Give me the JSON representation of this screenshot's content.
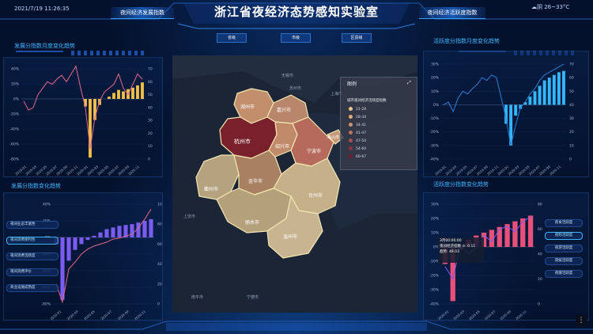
{
  "header": {
    "title": "浙江省夜经济态势感知实验室",
    "datetime": "2021/7/19 11:26:35",
    "weather": "阴 26~33°C",
    "tab_left": "夜间经济发展指数",
    "tab_right": "夜间经济活跃度指数",
    "subtabs": [
      "省级",
      "市级",
      "区县级"
    ]
  },
  "colors": {
    "accent": "#3fb6ff",
    "yellow": "#f0c04a",
    "pink": "#e05577",
    "purple": "#7a5cf0",
    "cyan": "#33b7ff",
    "line": "#e06a8a"
  },
  "panels": {
    "tl_title": "发展分指数月度变化趋势",
    "bl_title": "发展分指数变化趋势",
    "tr_title": "活跃度分指数月度变化趋势",
    "br_title": "活跃度分指数变化趋势"
  },
  "left_buttons": [
    "夜间业态丰富性",
    "夜间消费便利性",
    "夜间消费活跃度",
    "夜间消费评价",
    "商业设施成熟度"
  ],
  "right_buttons": [
    "夜食活跃度",
    "夜购活跃度",
    "夜游活跃度",
    "夜娱活跃度",
    "夜健活跃度"
  ],
  "map": {
    "legend_title": "图例",
    "legend_subtitle": "城市夜间经济活跃度指数",
    "legend_items": [
      {
        "label": "21-28",
        "color": "#e8c88a"
      },
      {
        "label": "28-34",
        "color": "#e0b07a"
      },
      {
        "label": "34-41",
        "color": "#d3926a"
      },
      {
        "label": "41-47",
        "color": "#c2715c"
      },
      {
        "label": "47-54",
        "color": "#a9504d"
      },
      {
        "label": "54-60",
        "color": "#8e3340"
      },
      {
        "label": "60-67",
        "color": "#731c30"
      }
    ],
    "cities": [
      "湖州市",
      "嘉兴市",
      "杭州市",
      "绍兴市",
      "宁波市",
      "舟山市",
      "衢州市",
      "金华市",
      "台州市",
      "丽水市",
      "温州市"
    ],
    "basemap_labels": [
      "无锡市",
      "苏州市",
      "上海市",
      "上饶市",
      "南平市",
      "宁德市"
    ]
  },
  "tooltip": {
    "line1": "3月00:00:00",
    "line2": "夜间经济指数 ⊙: 0.11",
    "line3": "趋势: 49.03"
  },
  "chart_data": [
    {
      "type": "bar",
      "title": "发展分指数月度变化趋势",
      "y_ticks": [
        "40%",
        "20%",
        "0%",
        "-20%",
        "-40%",
        "-60%",
        "-80%"
      ],
      "y2_ticks": [
        "70",
        "60",
        "50",
        "40",
        "30",
        "20",
        "10",
        "0"
      ],
      "x_ticks": [
        "2019-01",
        "2019-03",
        "2019-05",
        "2019-07",
        "2019-09",
        "2019-11",
        "2020-01",
        "2020-03",
        "2020-05",
        "2020-07",
        "2020-09",
        "2020-11"
      ],
      "series": [
        {
          "values": [
            0,
            0,
            0,
            0,
            0,
            0,
            0,
            0,
            0,
            0,
            0,
            0,
            0,
            -10,
            -78,
            -28,
            -8,
            0,
            3,
            8,
            12,
            10,
            13,
            15,
            18,
            22
          ]
        },
        {
          "values": [
            45,
            38,
            40,
            50,
            55,
            60,
            58,
            62,
            65,
            60,
            66,
            72,
            55,
            40,
            8,
            32,
            45,
            52,
            55,
            58,
            66,
            55,
            50,
            58,
            66,
            62
          ]
        }
      ]
    },
    {
      "type": "bar",
      "title": "发展分指数变化趋势",
      "y_ticks": [
        "40%",
        "20%",
        "0%",
        "-20%",
        "-40%",
        "-60%",
        "-80%"
      ],
      "y2_ticks": [
        "100",
        "80",
        "60",
        "40",
        "20",
        "0"
      ],
      "x_ticks": [
        "2020-01",
        "2020-03",
        "2020-05",
        "2020-07",
        "2020-09",
        "2020-11"
      ],
      "series": [
        {
          "values": [
            -8,
            -75,
            -28,
            -15,
            -8,
            -3,
            2,
            6,
            10,
            12,
            14,
            15,
            16,
            18,
            20,
            22
          ]
        },
        {
          "values": [
            20,
            2,
            35,
            42,
            50,
            55,
            58,
            60,
            62,
            65,
            66,
            68,
            70,
            76,
            85,
            95
          ]
        }
      ]
    },
    {
      "type": "bar",
      "title": "活跃度分指数月度变化趋势",
      "y_ticks": [
        "30%",
        "20%",
        "10%",
        "0%",
        "-10%",
        "-20%",
        "-30%",
        "-40%"
      ],
      "y2_ticks": [
        "70",
        "60",
        "50",
        "40",
        "30",
        "20",
        "10",
        "0"
      ],
      "x_ticks": [
        "2019-01",
        "2019-03",
        "2019-05",
        "2019-07",
        "2019-09",
        "2019-11",
        "2020-01",
        "2020-03",
        "2020-05",
        "2020-07",
        "2020-09",
        "2020-11"
      ],
      "series": [
        {
          "values": [
            0,
            0,
            0,
            0,
            0,
            0,
            0,
            0,
            0,
            0,
            0,
            0,
            0,
            -14,
            -30,
            -8,
            -3,
            2,
            6,
            10,
            14,
            18,
            20,
            22,
            24,
            25
          ]
        },
        {
          "values": [
            40,
            42,
            35,
            45,
            50,
            48,
            52,
            55,
            60,
            58,
            62,
            60,
            45,
            30,
            10,
            25,
            38,
            42,
            48,
            52,
            58,
            62,
            64,
            66,
            68,
            70
          ]
        }
      ]
    },
    {
      "type": "bar",
      "title": "活跃度分指数变化趋势",
      "y_ticks": [
        "30%",
        "20%",
        "10%",
        "0%",
        "-10%",
        "-20%",
        "-30%",
        "-40%"
      ],
      "y2_ticks": [
        "80",
        "60",
        "40",
        "20",
        "0"
      ],
      "x_ticks": [
        "2020-01",
        "2020-03",
        "2020-05",
        "2020-07",
        "2020-09",
        "2020-11"
      ],
      "series": [
        {
          "values": [
            -12,
            -38,
            -2,
            5,
            8,
            10,
            12,
            14,
            16,
            18,
            20,
            22
          ]
        },
        {
          "values": [
            30,
            20,
            48,
            40,
            45,
            55,
            50,
            60,
            62,
            58,
            66,
            70
          ]
        }
      ]
    }
  ]
}
